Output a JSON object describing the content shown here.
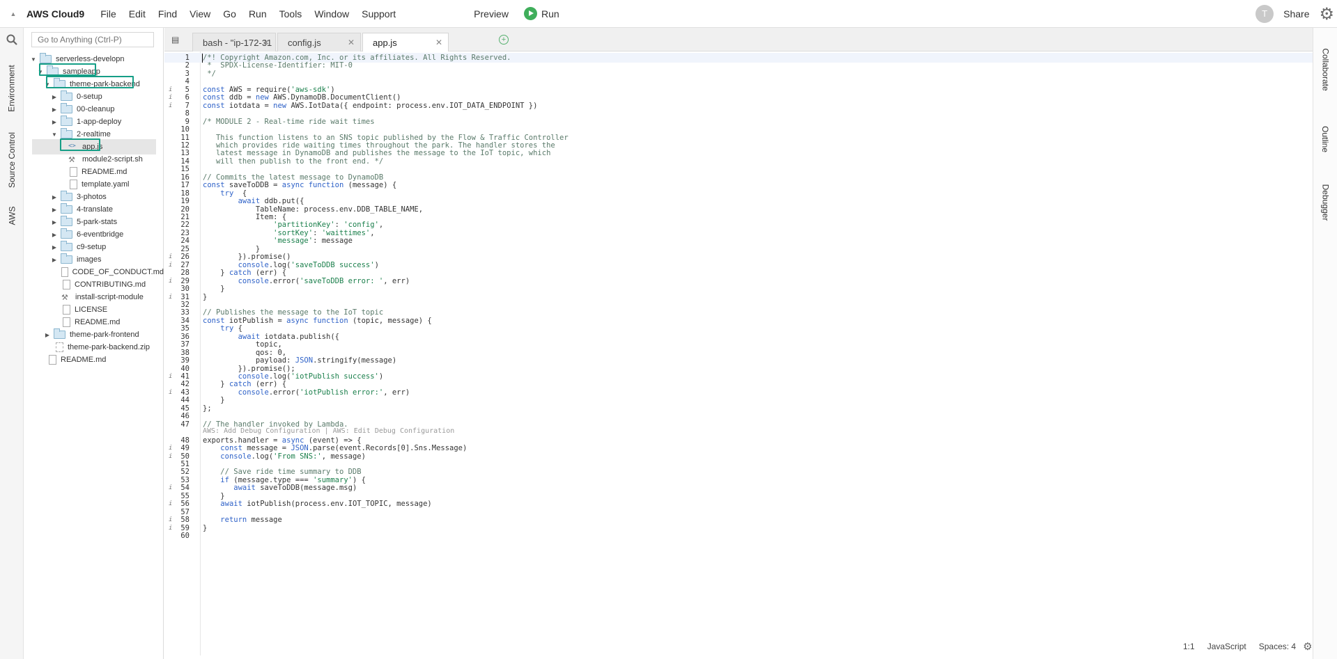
{
  "menubar": {
    "brand": "AWS Cloud9",
    "menus": [
      "File",
      "Edit",
      "Find",
      "View",
      "Go",
      "Run",
      "Tools",
      "Window",
      "Support"
    ],
    "preview": "Preview",
    "run": "Run",
    "avatar": "T",
    "share": "Share"
  },
  "left_rail": {
    "tabs": [
      "Environment",
      "Source Control",
      "AWS"
    ]
  },
  "right_rail": {
    "tabs": [
      "Collaborate",
      "Outline",
      "Debugger"
    ]
  },
  "tree": {
    "goto_placeholder": "Go to Anything (Ctrl-P)",
    "items": [
      {
        "label": "serverless-developn",
        "type": "folder",
        "level": 0,
        "caret": "open"
      },
      {
        "label": "sampleapp",
        "type": "folder",
        "level": 1,
        "caret": "open",
        "highlight": true
      },
      {
        "label": "theme-park-backend",
        "type": "folder",
        "level": 2,
        "caret": "open",
        "highlight": true
      },
      {
        "label": "0-setup",
        "type": "folder",
        "level": 3,
        "caret": "closed"
      },
      {
        "label": "00-cleanup",
        "type": "folder",
        "level": 3,
        "caret": "closed"
      },
      {
        "label": "1-app-deploy",
        "type": "folder",
        "level": 3,
        "caret": "closed"
      },
      {
        "label": "2-realtime",
        "type": "folder",
        "level": 3,
        "caret": "open"
      },
      {
        "label": "app.js",
        "type": "code",
        "level": 4,
        "selected": true,
        "highlight": true
      },
      {
        "label": "module2-script.sh",
        "type": "script",
        "level": 4
      },
      {
        "label": "README.md",
        "type": "file",
        "level": 4
      },
      {
        "label": "template.yaml",
        "type": "file",
        "level": 4
      },
      {
        "label": "3-photos",
        "type": "folder",
        "level": 3,
        "caret": "closed"
      },
      {
        "label": "4-translate",
        "type": "folder",
        "level": 3,
        "caret": "closed"
      },
      {
        "label": "5-park-stats",
        "type": "folder",
        "level": 3,
        "caret": "closed"
      },
      {
        "label": "6-eventbridge",
        "type": "folder",
        "level": 3,
        "caret": "closed"
      },
      {
        "label": "c9-setup",
        "type": "folder",
        "level": 3,
        "caret": "closed"
      },
      {
        "label": "images",
        "type": "folder",
        "level": 3,
        "caret": "closed"
      },
      {
        "label": "CODE_OF_CONDUCT.md",
        "type": "file",
        "level": 3
      },
      {
        "label": "CONTRIBUTING.md",
        "type": "file",
        "level": 3
      },
      {
        "label": "install-script-module",
        "type": "script",
        "level": 3
      },
      {
        "label": "LICENSE",
        "type": "file",
        "level": 3
      },
      {
        "label": "README.md",
        "type": "file",
        "level": 3
      },
      {
        "label": "theme-park-frontend",
        "type": "folder",
        "level": 2,
        "caret": "closed"
      },
      {
        "label": "theme-park-backend.zip",
        "type": "zip",
        "level": 2
      },
      {
        "label": "README.md",
        "type": "file",
        "level": 1
      }
    ]
  },
  "tabs": [
    {
      "label": "bash - \"ip-172-31",
      "active": false
    },
    {
      "label": "config.js",
      "active": false
    },
    {
      "label": "app.js",
      "active": true
    }
  ],
  "editor": {
    "codelens": "AWS: Add Debug Configuration | AWS: Edit Debug Configuration",
    "lines": [
      {
        "n": "1",
        "t": "/*! Copyright Amazon.com, Inc. or its affiliates. All Rights Reserved."
      },
      {
        "n": "2",
        "t": " *  SPDX-License-Identifier: MIT-0"
      },
      {
        "n": "3",
        "t": " */"
      },
      {
        "n": "4",
        "t": ""
      },
      {
        "n": "5",
        "t": "const AWS = require('aws-sdk')",
        "i": true
      },
      {
        "n": "6",
        "t": "const ddb = new AWS.DynamoDB.DocumentClient()",
        "i": true
      },
      {
        "n": "7",
        "t": "const iotdata = new AWS.IotData({ endpoint: process.env.IOT_DATA_ENDPOINT })",
        "i": true
      },
      {
        "n": "8",
        "t": ""
      },
      {
        "n": "9",
        "t": "/* MODULE 2 - Real-time ride wait times"
      },
      {
        "n": "10",
        "t": ""
      },
      {
        "n": "11",
        "t": "   This function listens to an SNS topic published by the Flow & Traffic Controller"
      },
      {
        "n": "12",
        "t": "   which provides ride waiting times throughout the park. The handler stores the"
      },
      {
        "n": "13",
        "t": "   latest message in DynamoDB and publishes the message to the IoT topic, which"
      },
      {
        "n": "14",
        "t": "   will then publish to the front end. */"
      },
      {
        "n": "15",
        "t": ""
      },
      {
        "n": "16",
        "t": "// Commits the latest message to DynamoDB"
      },
      {
        "n": "17",
        "t": "const saveToDDB = async function (message) {"
      },
      {
        "n": "18",
        "t": "    try  {"
      },
      {
        "n": "19",
        "t": "        await ddb.put({"
      },
      {
        "n": "20",
        "t": "            TableName: process.env.DDB_TABLE_NAME,"
      },
      {
        "n": "21",
        "t": "            Item: {"
      },
      {
        "n": "22",
        "t": "                'partitionKey': 'config',"
      },
      {
        "n": "23",
        "t": "                'sortKey': 'waittimes',"
      },
      {
        "n": "24",
        "t": "                'message': message"
      },
      {
        "n": "25",
        "t": "            }"
      },
      {
        "n": "26",
        "t": "        }).promise()",
        "i": true
      },
      {
        "n": "27",
        "t": "        console.log('saveToDDB success')",
        "i": true
      },
      {
        "n": "28",
        "t": "    } catch (err) {"
      },
      {
        "n": "29",
        "t": "        console.error('saveToDDB error: ', err)",
        "i": true
      },
      {
        "n": "30",
        "t": "    }"
      },
      {
        "n": "31",
        "t": "}",
        "i": true
      },
      {
        "n": "32",
        "t": ""
      },
      {
        "n": "33",
        "t": "// Publishes the message to the IoT topic"
      },
      {
        "n": "34",
        "t": "const iotPublish = async function (topic, message) {"
      },
      {
        "n": "35",
        "t": "    try {"
      },
      {
        "n": "36",
        "t": "        await iotdata.publish({"
      },
      {
        "n": "37",
        "t": "            topic,"
      },
      {
        "n": "38",
        "t": "            qos: 0,"
      },
      {
        "n": "39",
        "t": "            payload: JSON.stringify(message)"
      },
      {
        "n": "40",
        "t": "        }).promise();"
      },
      {
        "n": "41",
        "t": "        console.log('iotPublish success')",
        "i": true
      },
      {
        "n": "42",
        "t": "    } catch (err) {"
      },
      {
        "n": "43",
        "t": "        console.error('iotPublish error:', err)",
        "i": true
      },
      {
        "n": "44",
        "t": "    }"
      },
      {
        "n": "45",
        "t": "};"
      },
      {
        "n": "46",
        "t": ""
      },
      {
        "n": "47",
        "t": "// The handler invoked by Lambda."
      },
      {
        "n": "48",
        "t": "exports.handler = async (event) => {"
      },
      {
        "n": "49",
        "t": "    const message = JSON.parse(event.Records[0].Sns.Message)",
        "i": true
      },
      {
        "n": "50",
        "t": "    console.log('From SNS:', message)",
        "i": true
      },
      {
        "n": "51",
        "t": ""
      },
      {
        "n": "52",
        "t": "    // Save ride time summary to DDB"
      },
      {
        "n": "53",
        "t": "    if (message.type === 'summary') {"
      },
      {
        "n": "54",
        "t": "       await saveToDDB(message.msg)",
        "i": true
      },
      {
        "n": "55",
        "t": "    }"
      },
      {
        "n": "56",
        "t": "    await iotPublish(process.env.IOT_TOPIC, message)",
        "i": true
      },
      {
        "n": "57",
        "t": ""
      },
      {
        "n": "58",
        "t": "    return message",
        "i": true
      },
      {
        "n": "59",
        "t": "}",
        "i": true
      },
      {
        "n": "60",
        "t": ""
      }
    ]
  },
  "status": {
    "position": "1:1",
    "language": "JavaScript",
    "spaces": "Spaces: 4"
  }
}
